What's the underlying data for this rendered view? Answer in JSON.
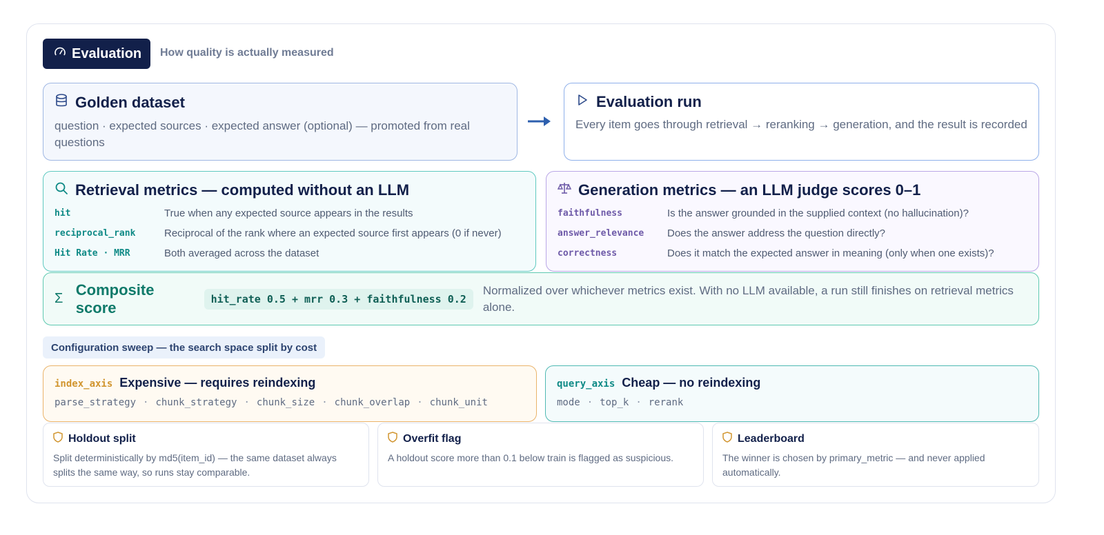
{
  "header": {
    "title": "Evaluation",
    "subtitle": "How quality is actually measured",
    "icon": "gauge-icon"
  },
  "golden": {
    "icon": "database-icon",
    "title": "Golden dataset",
    "description": "question · expected sources · expected answer (optional) — promoted from real questions"
  },
  "eval_run": {
    "icon": "play-icon",
    "title": "Evaluation run",
    "description": "Every item goes through retrieval → reranking → generation, and the result is recorded"
  },
  "retrieval": {
    "icon": "search-icon",
    "title": "Retrieval metrics — computed without an LLM",
    "metrics": [
      {
        "key": "hit",
        "desc": "True when any expected source appears in the results"
      },
      {
        "key": "reciprocal_rank",
        "desc": "Reciprocal of the rank where an expected source first appears (0 if never)"
      },
      {
        "key": "Hit Rate · MRR",
        "desc": "Both averaged across the dataset"
      }
    ]
  },
  "generation": {
    "icon": "scale-icon",
    "title": "Generation metrics — an LLM judge scores 0–1",
    "metrics": [
      {
        "key": "faithfulness",
        "desc": "Is the answer grounded in the supplied context (no hallucination)?"
      },
      {
        "key": "answer_relevance",
        "desc": "Does the answer address the question directly?"
      },
      {
        "key": "correctness",
        "desc": "Does it match the expected answer in meaning (only when one exists)?"
      }
    ]
  },
  "composite": {
    "icon": "sigma-icon",
    "title": "Composite score",
    "formula": "hit_rate 0.5 + mrr 0.3 + faithfulness 0.2",
    "description": "Normalized over whichever metrics exist. With no LLM available, a run still finishes on retrieval metrics alone."
  },
  "sweep": {
    "label": "Configuration sweep — the search space split by cost",
    "index_axis": {
      "tag": "index_axis",
      "title": "Expensive — requires reindexing",
      "params": [
        "parse_strategy",
        "chunk_strategy",
        "chunk_size",
        "chunk_overlap",
        "chunk_unit"
      ]
    },
    "query_axis": {
      "tag": "query_axis",
      "title": "Cheap — no reindexing",
      "params": [
        "mode",
        "top_k",
        "rerank"
      ]
    }
  },
  "notes": [
    {
      "icon": "shield-icon",
      "title": "Holdout split",
      "description": "Split deterministically by md5(item_id) — the same dataset always splits the same way, so runs stay comparable."
    },
    {
      "icon": "shield-icon",
      "title": "Overfit flag",
      "description": "A holdout score more than 0.1 below train is flagged as suspicious."
    },
    {
      "icon": "shield-icon",
      "title": "Leaderboard",
      "description": "The winner is chosen by primary_metric — and never applied automatically."
    }
  ],
  "colors": {
    "header_bg": "#12204a",
    "retrieval_accent": "#0f8a86",
    "generation_accent": "#6e5aa8",
    "composite_accent": "#0f7a6a",
    "index_accent": "#d1952f",
    "arrow": "#2d5fae"
  }
}
